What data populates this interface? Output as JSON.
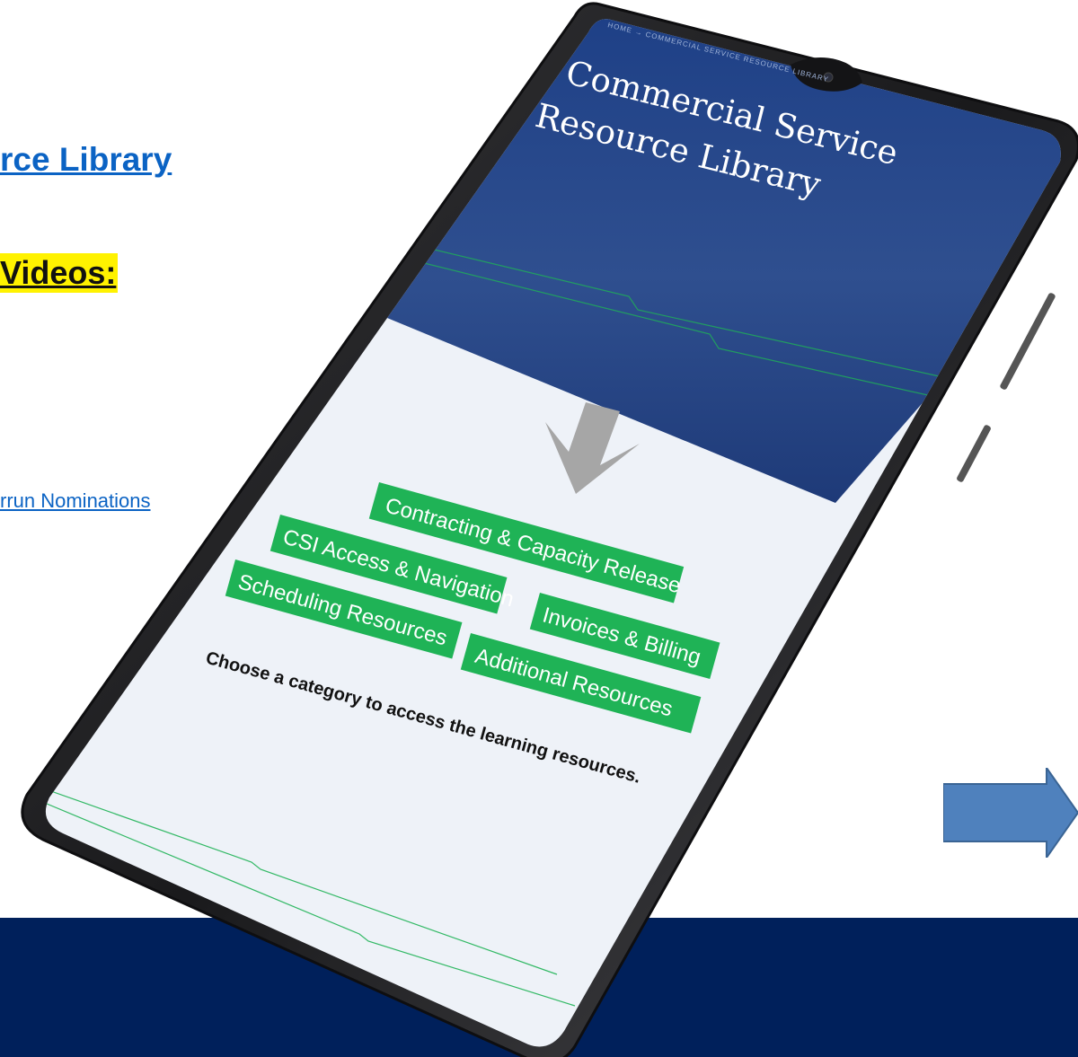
{
  "left_panel": {
    "library_link": "rce Library",
    "videos_heading": "Videos:",
    "nominations_link": "rrun Nominations"
  },
  "phone": {
    "breadcrumb": "HOME → COMMERCIAL SERVICE RESOURCE LIBRARY",
    "title_line1": "Commercial Service",
    "title_line2": "Resource Library",
    "buttons": {
      "contracting": "Contracting & Capacity Release",
      "csi": "CSI Access & Navigation",
      "invoices": "Invoices & Billing",
      "scheduling": "Scheduling Resources",
      "additional": "Additional Resources"
    },
    "instruction": "Choose a category to access the learning resources."
  },
  "colors": {
    "footer": "#00205b",
    "button_green": "#1fb356",
    "link_blue": "#0b63c4",
    "highlight": "#fff200",
    "arrow_blue": "#4f81bd"
  },
  "icons": {
    "down_arrow": "down-arrow-icon",
    "right_arrow": "right-arrow-icon",
    "camera": "camera-icon"
  }
}
